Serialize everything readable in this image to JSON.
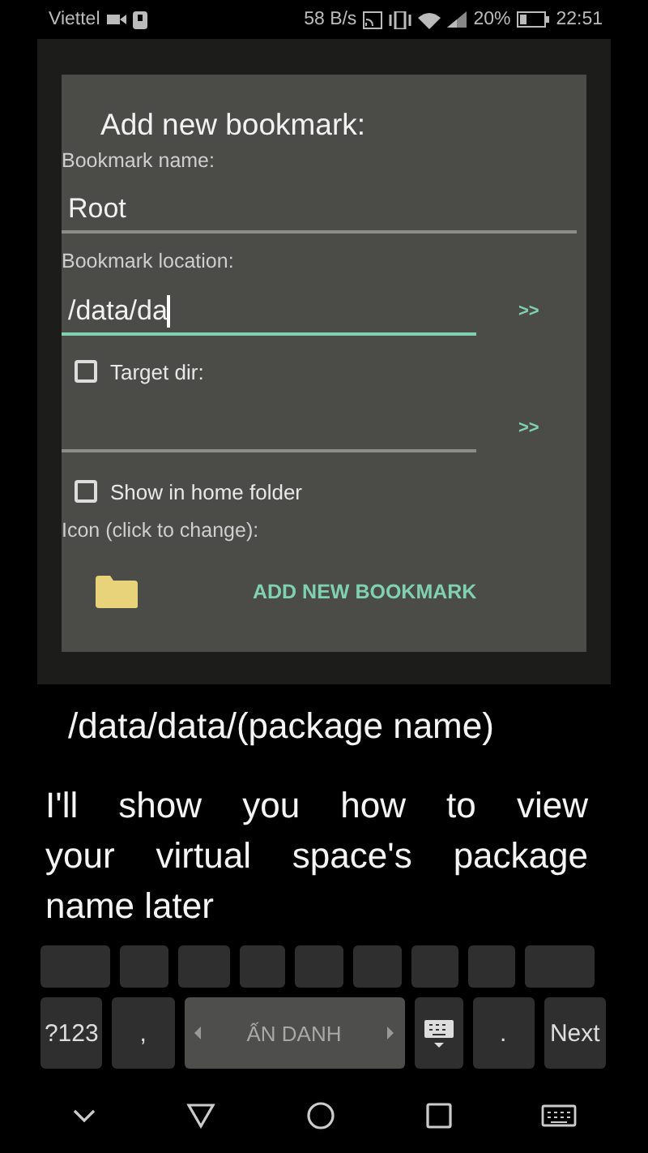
{
  "status_bar": {
    "carrier": "Viettel",
    "net_speed": "58 B/s",
    "battery": "20%",
    "time": "22:51"
  },
  "dialog": {
    "title": "Add new bookmark:",
    "name_label": "Bookmark name:",
    "name_value": "Root",
    "location_label": "Bookmark location:",
    "location_value": "/data/da",
    "location_focused": true,
    "browse_buttons": [
      ">>",
      ">>"
    ],
    "checkboxes": [
      {
        "label": "Target dir:",
        "checked": false
      },
      {
        "label": "Show in home folder",
        "checked": false
      }
    ],
    "icon_label": "Icon (click to change):",
    "add_button": "ADD NEW BOOKMARK"
  },
  "subtitles": [
    {
      "lines": [
        "/data/data/(package name)"
      ]
    },
    {
      "lines": [
        "I'll show you how to view",
        "your virtual space's package",
        "name later"
      ]
    }
  ],
  "keyboard": {
    "bottom_row": [
      {
        "kind": "text",
        "label": "?123"
      },
      {
        "kind": "text",
        "label": ","
      },
      {
        "kind": "space",
        "label": "ẤN DANH"
      },
      {
        "kind": "switch"
      },
      {
        "kind": "text",
        "label": "."
      },
      {
        "kind": "text",
        "label": "Next"
      }
    ]
  }
}
